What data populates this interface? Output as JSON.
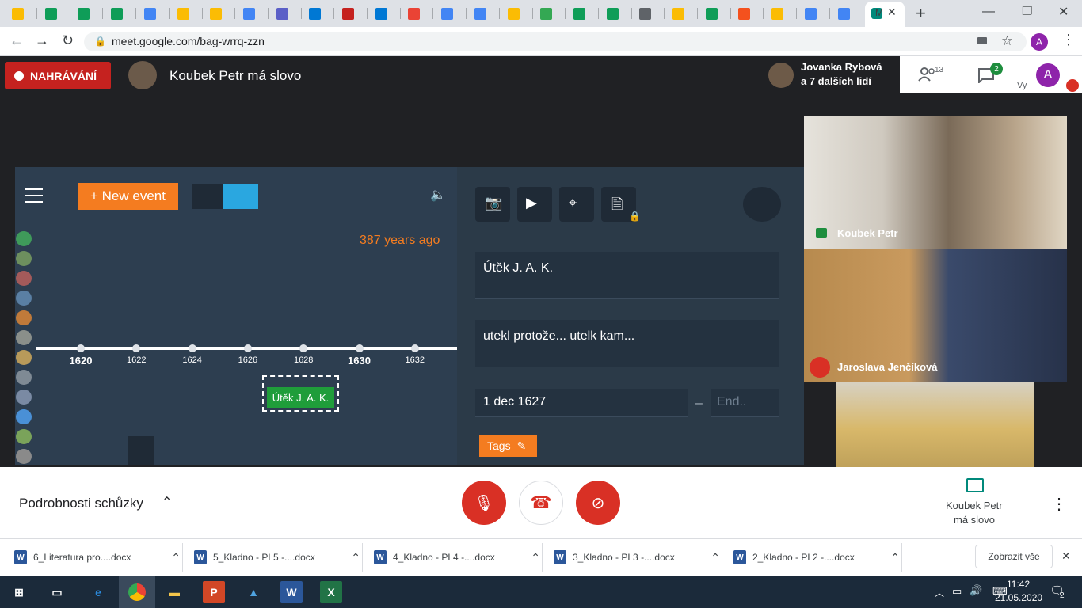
{
  "browser": {
    "tabs": [
      "",
      "",
      "",
      "",
      "",
      "",
      "",
      "",
      "",
      "",
      "",
      "",
      "",
      "",
      "",
      "",
      "",
      "",
      "",
      "",
      "",
      "",
      "",
      "",
      "",
      "",
      "M"
    ],
    "tab_colors": [
      "#fbbc04",
      "#0f9d58",
      "#0f9d58",
      "#0f9d58",
      "#4285f4",
      "#fbbc04",
      "#fbbc04",
      "#4285f4",
      "#5b5fc7",
      "#0078d4",
      "#c5221f",
      "#0078d4",
      "#ea4335",
      "#4285f4",
      "#4285f4",
      "#fbbc04",
      "#34a853",
      "#0f9d58",
      "#0f9d58",
      "#5f6368",
      "#fbbc04",
      "#0f9d58",
      "#f4511e",
      "#fbbc04",
      "#4285f4",
      "#4285f4",
      "#00897b"
    ],
    "url": "meet.google.com/bag-wrrq-zzn",
    "profile_initial": "A"
  },
  "meet": {
    "recording_label": "NAHRÁVÁNÍ",
    "speaker_title": "Koubek Petr má slovo",
    "participants_line1": "Jovanka Rybová",
    "participants_line2": "a 7 dalších lidí",
    "people_count": "13",
    "chat_count": "2",
    "you_label": "Vy",
    "you_initial": "A"
  },
  "timeline": {
    "new_event_label": "+ New event",
    "years_ago": "387 years ago",
    "event_label": "Útěk J. A. K.",
    "years": [
      {
        "label": "1620",
        "big": true
      },
      {
        "label": "1622",
        "big": false
      },
      {
        "label": "1624",
        "big": false
      },
      {
        "label": "1626",
        "big": false
      },
      {
        "label": "1628",
        "big": false
      },
      {
        "label": "1630",
        "big": true
      },
      {
        "label": "1632",
        "big": false
      }
    ],
    "title_value": "Útěk J. A. K.",
    "description_value": "utekl protože... utelk kam...",
    "start_date": "1 dec 1627",
    "dash": "–",
    "end_placeholder": "End..",
    "tags_label": "Tags"
  },
  "videos": [
    {
      "name": "Koubek Petr",
      "muted": false
    },
    {
      "name": "Jaroslava Jenčíková",
      "muted": true
    },
    {
      "name": "",
      "muted": false
    }
  ],
  "controls": {
    "details_label": "Podrobnosti schůzky",
    "present_line1": "Koubek Petr",
    "present_line2": "má slovo"
  },
  "downloads": {
    "items": [
      "6_Literatura pro....docx",
      "5_Kladno - PL5 -....docx",
      "4_Kladno - PL4 -....docx",
      "3_Kladno - PL3 -....docx",
      "2_Kladno - PL2 -....docx"
    ],
    "show_all": "Zobrazit vše"
  },
  "taskbar": {
    "time": "11:42",
    "date": "21.05.2020",
    "notif_count": "2"
  }
}
